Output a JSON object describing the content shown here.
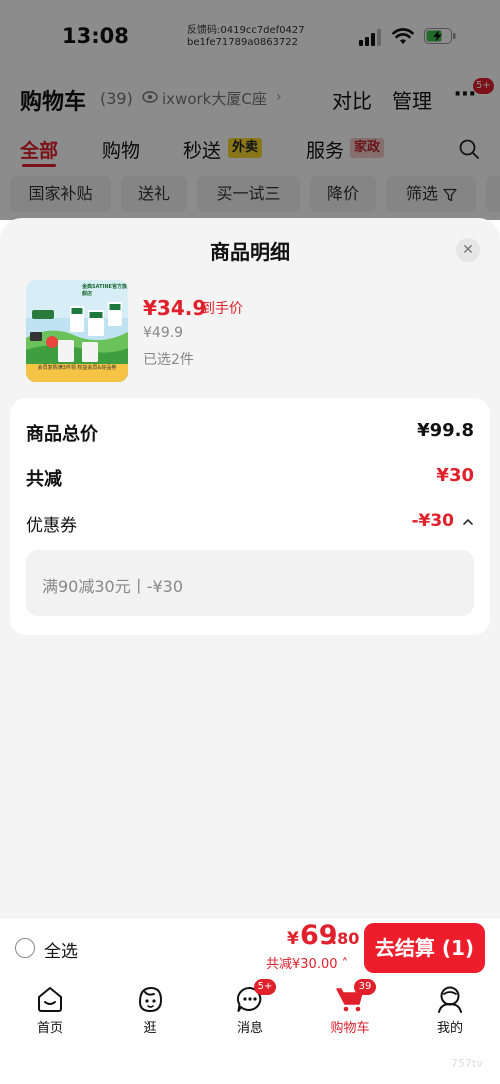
{
  "status_bar": {
    "time": "13:08",
    "feedback_id_line1": "反馈码:0419cc7def0427",
    "feedback_id_line2": "be1fe71789a0863722"
  },
  "cart_header": {
    "title": "购物车",
    "count": "(39)",
    "location": "ixwork大厦C座",
    "compare": "对比",
    "manage": "管理",
    "more_badge": "5+"
  },
  "category_tabs": [
    {
      "label": "全部"
    },
    {
      "label": "购物"
    },
    {
      "label": "秒送",
      "tag": "外卖"
    },
    {
      "label": "服务",
      "tag": "家政"
    }
  ],
  "filter_chips": [
    "国家补贴",
    "送礼",
    "买一试三",
    "降价",
    "筛选"
  ],
  "sheet": {
    "title": "商品明细",
    "product": {
      "thumb_badge": "金典SATINE官方旗舰店",
      "thumb_footer": "会员复购满3件领 权益会员&好品券",
      "price": "¥34.9",
      "price_tag": "到手价",
      "original_price": "¥49.9",
      "selected": "已选2件"
    },
    "summary": {
      "total_label": "商品总价",
      "total_value": "¥99.8",
      "reduce_label": "共减",
      "reduce_value": "¥30",
      "coupon_label": "优惠券",
      "coupon_value": "-¥30",
      "coupon_detail": "满90减30元丨-¥30"
    }
  },
  "checkout": {
    "select_all": "全选",
    "currency": "¥",
    "total_int": "69",
    "total_dec": ".80",
    "discount": "共减¥30.00",
    "button": "去结算 (1)"
  },
  "tabbar": [
    {
      "label": "首页",
      "icon": "home-icon"
    },
    {
      "label": "逛",
      "icon": "browse-icon"
    },
    {
      "label": "消息",
      "icon": "message-icon",
      "badge": "5+"
    },
    {
      "label": "购物车",
      "icon": "cart-icon",
      "badge": "39",
      "active": true
    },
    {
      "label": "我的",
      "icon": "profile-icon"
    }
  ],
  "watermark": "757tv",
  "colors": {
    "accent": "#e0202a",
    "checkout_button": "#ee1d2b",
    "sheet_bg": "#f4f4f4"
  }
}
